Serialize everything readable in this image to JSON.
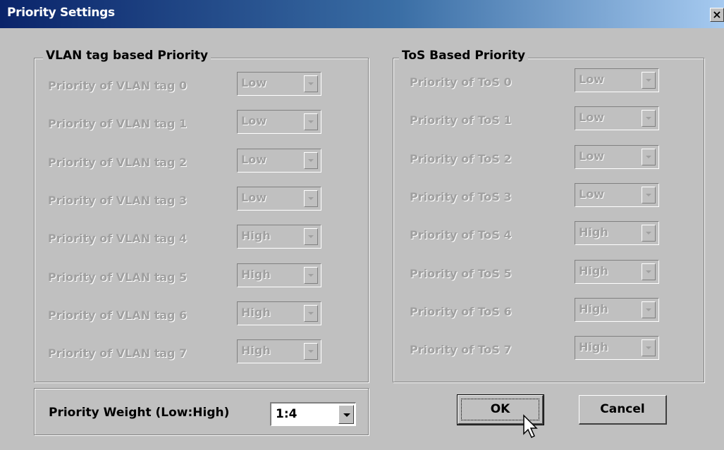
{
  "window": {
    "title": "Priority Settings",
    "close_symbol": "×"
  },
  "vlan_group": {
    "title": "VLAN tag based Priority",
    "rows": [
      {
        "label": "Priority of VLAN tag 0",
        "value": "Low"
      },
      {
        "label": "Priority of VLAN tag 1",
        "value": "Low"
      },
      {
        "label": "Priority of VLAN tag 2",
        "value": "Low"
      },
      {
        "label": "Priority of VLAN tag 3",
        "value": "Low"
      },
      {
        "label": "Priority of VLAN tag 4",
        "value": "High"
      },
      {
        "label": "Priority of VLAN tag 5",
        "value": "High"
      },
      {
        "label": "Priority of VLAN tag 6",
        "value": "High"
      },
      {
        "label": "Priority of VLAN tag 7",
        "value": "High"
      }
    ]
  },
  "tos_group": {
    "title": "ToS Based Priority",
    "rows": [
      {
        "label": "Priority of ToS 0",
        "value": "Low"
      },
      {
        "label": "Priority of ToS 1",
        "value": "Low"
      },
      {
        "label": "Priority of ToS 2",
        "value": "Low"
      },
      {
        "label": "Priority of ToS 3",
        "value": "Low"
      },
      {
        "label": "Priority of ToS 4",
        "value": "High"
      },
      {
        "label": "Priority of ToS 5",
        "value": "High"
      },
      {
        "label": "Priority of ToS 6",
        "value": "High"
      },
      {
        "label": "Priority of ToS 7",
        "value": "High"
      }
    ]
  },
  "weight": {
    "label": "Priority Weight (Low:High)",
    "value": "1:4"
  },
  "buttons": {
    "ok": "OK",
    "cancel": "Cancel"
  },
  "colors": {
    "title_start": "#0a246a",
    "title_end": "#a6caf0",
    "face": "#c0c0c0",
    "disabled_text": "#a0a0a0"
  }
}
